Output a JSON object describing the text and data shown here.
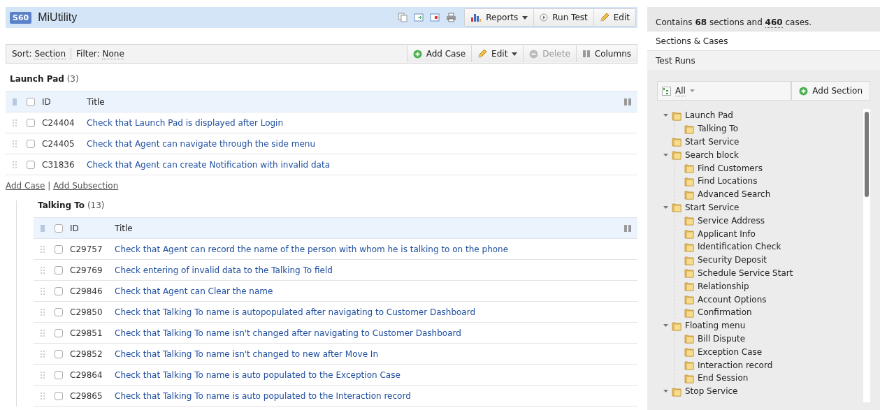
{
  "header": {
    "badge": "S60",
    "title": "MiUtility",
    "icons": [
      {
        "kind": "copy"
      },
      {
        "kind": "export"
      },
      {
        "kind": "import"
      },
      {
        "kind": "print"
      }
    ],
    "buttons": [
      {
        "label": "Reports",
        "kind": "reports"
      },
      {
        "label": "Run Test",
        "kind": "run"
      },
      {
        "label": "Edit",
        "kind": "edit"
      }
    ]
  },
  "toolbar": {
    "sort_label": "Sort:",
    "sort_value": "Section",
    "filter_label": "Filter:",
    "filter_value": "None",
    "buttons": [
      {
        "label": "Add Case",
        "kind": "add",
        "disabled": false
      },
      {
        "label": "Edit",
        "kind": "edit",
        "disabled": false
      },
      {
        "label": "Delete",
        "kind": "delete",
        "disabled": true
      },
      {
        "label": "Columns",
        "kind": "columns",
        "disabled": false
      }
    ]
  },
  "sections": [
    {
      "name": "Launch Pad",
      "count": "(3)",
      "columns": [
        "ID",
        "Title"
      ],
      "rows": [
        {
          "id": "C24404",
          "title": "Check that Launch Pad is displayed after Login",
          "checked": false
        },
        {
          "id": "C24405",
          "title": "Check that Agent can navigate through the side menu",
          "checked": false
        },
        {
          "id": "C31836",
          "title": "Check that Agent can create Notification with invalid data",
          "checked": false
        }
      ],
      "select_all_checked": false,
      "links": [
        "Add Case",
        "Add Subsection"
      ],
      "link_separator": "|",
      "children": [
        {
          "name": "Talking To",
          "count": "(13)",
          "columns": [
            "ID",
            "Title"
          ],
          "select_all_checked": false,
          "rows": [
            {
              "id": "C29757",
              "title": "Check that Agent can record the name of the person with whom he is talking to on the phone",
              "checked": false
            },
            {
              "id": "C29769",
              "title": "Check entering of invalid data to the Talking To field",
              "checked": false
            },
            {
              "id": "C29846",
              "title": "Check that Agent can Clear the name",
              "checked": false
            },
            {
              "id": "C29850",
              "title": "Check that Talking To name is autopopulated after navigating to Customer Dashboard",
              "checked": false
            },
            {
              "id": "C29851",
              "title": "Check that Talking To name isn't changed after navigating to Customer Dashboard",
              "checked": false
            },
            {
              "id": "C29852",
              "title": "Check that Talking To name isn't changed to new after Move In",
              "checked": false
            },
            {
              "id": "C29864",
              "title": "Check that Talking To name is auto populated to the Exception Case",
              "checked": false
            },
            {
              "id": "C29865",
              "title": "Check that Talking To name is auto populated to the Interaction record",
              "checked": false
            }
          ]
        }
      ]
    }
  ],
  "summary": "Contains **68** sections and **460** cases.",
  "tabs": [
    {
      "label": "Sections & Cases",
      "selected": true
    },
    {
      "label": "Test Runs",
      "selected": false
    }
  ],
  "tree_toolbar": {
    "filter": "All",
    "button": "Add Section"
  },
  "tree": [
    {
      "name": "Launch Pad",
      "expanded": true,
      "children": [
        {
          "name": "Talking To"
        }
      ]
    },
    {
      "name": "Start Service"
    },
    {
      "name": "Search block",
      "expanded": true,
      "children": [
        {
          "name": "Find Customers"
        },
        {
          "name": "Find Locations"
        },
        {
          "name": "Advanced Search"
        }
      ]
    },
    {
      "name": "Start Service",
      "expanded": true,
      "children": [
        {
          "name": "Service Address"
        },
        {
          "name": "Applicant Info"
        },
        {
          "name": "Identification Check"
        },
        {
          "name": "Security Deposit"
        },
        {
          "name": "Schedule Service Start"
        },
        {
          "name": "Relationship"
        },
        {
          "name": "Account Options"
        },
        {
          "name": "Confirmation"
        }
      ]
    },
    {
      "name": "Floating menu",
      "expanded": true,
      "children": [
        {
          "name": "Bill Dispute"
        },
        {
          "name": "Exception Case"
        },
        {
          "name": "Interaction record"
        },
        {
          "name": "End Session"
        }
      ]
    },
    {
      "name": "Stop Service",
      "expanded": true
    }
  ]
}
